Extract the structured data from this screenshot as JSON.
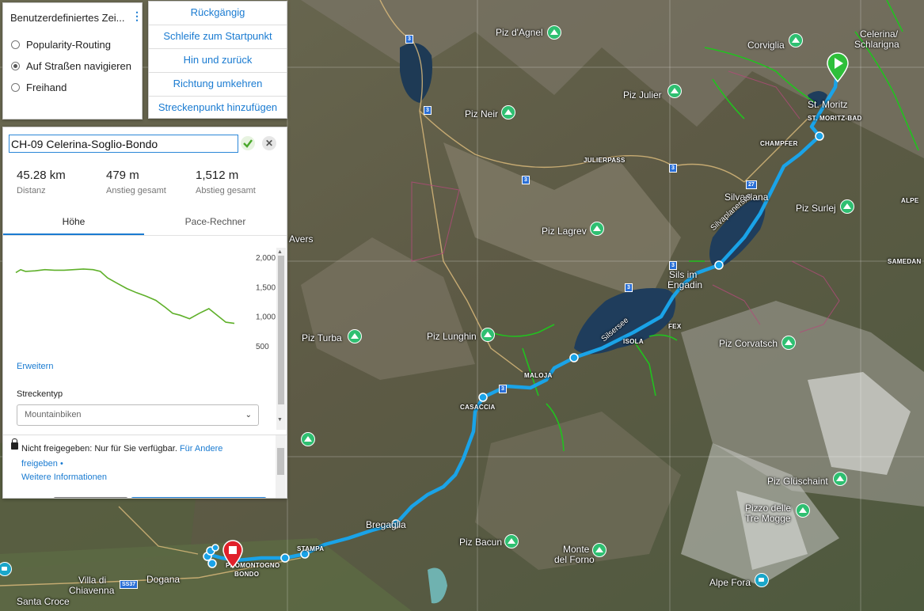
{
  "routing_panel": {
    "title": "Benutzerdefiniertes Zei...",
    "options": [
      {
        "label": "Popularity-Routing",
        "checked": false
      },
      {
        "label": "Auf Straßen navigieren",
        "checked": true
      },
      {
        "label": "Freihand",
        "checked": false
      }
    ]
  },
  "action_menu": {
    "items": [
      "Rückgängig",
      "Schleife zum Startpunkt",
      "Hin und zurück",
      "Richtung umkehren",
      "Streckenpunkt hinzufügen"
    ]
  },
  "route": {
    "name": "CH-09 Celerina-Soglio-Bondo",
    "stats": [
      {
        "value": "45.28 km",
        "label": "Distanz"
      },
      {
        "value": "479 m",
        "label": "Anstieg gesamt"
      },
      {
        "value": "1,512 m",
        "label": "Abstieg gesamt"
      }
    ],
    "tabs": [
      "Höhe",
      "Pace-Rechner"
    ],
    "active_tab": "Höhe",
    "expand_link": "Erweitern",
    "type_label": "Streckentyp",
    "type_value": "Mountainbiken"
  },
  "sharing": {
    "text": "Nicht freigegeben: Nur für Sie verfügbar.",
    "link1": "Für Andere",
    "link2": "freigeben",
    "bullet": "•",
    "more": "Weitere Informationen"
  },
  "chart_data": {
    "type": "line",
    "title": "",
    "xlabel": "",
    "ylabel": "",
    "yticks": [
      "2,000",
      "1,500",
      "1,000",
      "500"
    ],
    "ylim": [
      500,
      2000
    ],
    "xlim": [
      0,
      45.28
    ],
    "color": "#5fb02a",
    "series": [
      {
        "x": [
          0,
          1,
          2,
          4,
          6,
          8,
          10,
          12,
          14,
          16,
          17.5,
          19,
          21,
          23,
          25,
          27,
          29,
          31,
          32.5,
          34,
          36,
          38,
          40,
          42,
          43.5,
          45.28
        ],
        "values": [
          1740,
          1790,
          1760,
          1770,
          1790,
          1780,
          1780,
          1790,
          1800,
          1790,
          1760,
          1650,
          1560,
          1470,
          1400,
          1340,
          1270,
          1150,
          1050,
          1020,
          960,
          1050,
          1130,
          1000,
          900,
          880
        ]
      }
    ]
  },
  "map": {
    "labels": [
      {
        "text": "Piz d'Agnel",
        "cls": ""
      },
      {
        "text": "Corviglia",
        "cls": ""
      },
      {
        "text": "Celerina/",
        "cls": ""
      },
      {
        "text": "Schlarigna",
        "cls": ""
      },
      {
        "text": "Piz Julier",
        "cls": ""
      },
      {
        "text": "Piz Neir",
        "cls": ""
      },
      {
        "text": "St. Moritz",
        "cls": ""
      },
      {
        "text": "ST. MORITZ-BAD",
        "cls": "small"
      },
      {
        "text": "CHAMPFER",
        "cls": "small"
      },
      {
        "text": "JULIERPASS",
        "cls": "small"
      },
      {
        "text": "Silvaplana",
        "cls": ""
      },
      {
        "text": "Piz Surlej",
        "cls": ""
      },
      {
        "text": "ALPE",
        "cls": "small"
      },
      {
        "text": "Piz Lagrev",
        "cls": ""
      },
      {
        "text": "Silvaplanersee",
        "cls": "lake"
      },
      {
        "text": "SAMEDAN",
        "cls": "small"
      },
      {
        "text": "Avers",
        "cls": ""
      },
      {
        "text": "Sils im",
        "cls": ""
      },
      {
        "text": "Engadin",
        "cls": ""
      },
      {
        "text": "FEX",
        "cls": "small"
      },
      {
        "text": "Silsersee",
        "cls": "lake"
      },
      {
        "text": "ISOLA",
        "cls": "small"
      },
      {
        "text": "Piz Turba",
        "cls": ""
      },
      {
        "text": "Piz Lunghin",
        "cls": ""
      },
      {
        "text": "Piz Corvatsch",
        "cls": ""
      },
      {
        "text": "MALOJA",
        "cls": "small"
      },
      {
        "text": "CASACCIA",
        "cls": "small"
      },
      {
        "text": "Piz Glüschaint",
        "cls": ""
      },
      {
        "text": "Pizzo delle",
        "cls": ""
      },
      {
        "text": "Tre Mogge",
        "cls": ""
      },
      {
        "text": "Bregaglia",
        "cls": ""
      },
      {
        "text": "Piz Bacun",
        "cls": ""
      },
      {
        "text": "Monte",
        "cls": ""
      },
      {
        "text": "del Forno",
        "cls": ""
      },
      {
        "text": "STAMPA",
        "cls": "small"
      },
      {
        "text": "PROMONTOGNO",
        "cls": "small"
      },
      {
        "text": "BONDO",
        "cls": "small"
      },
      {
        "text": "Villa di",
        "cls": ""
      },
      {
        "text": "Chiavenna",
        "cls": ""
      },
      {
        "text": "Dogana",
        "cls": ""
      },
      {
        "text": "Alpe Fora",
        "cls": ""
      },
      {
        "text": "Santa Croce",
        "cls": ""
      }
    ],
    "shields": [
      "3",
      "3",
      "3",
      "3",
      "3",
      "3",
      "27",
      "3",
      "SS37"
    ]
  }
}
